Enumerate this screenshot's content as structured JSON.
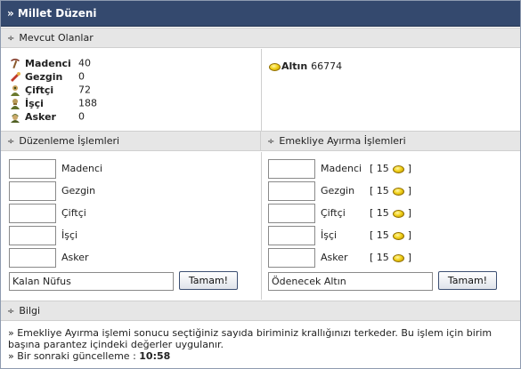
{
  "title": "» Millet Düzeni",
  "sections": {
    "current": "Mevcut Olanlar",
    "edit": "Düzenleme İşlemleri",
    "retire": "Emekliye Ayırma İşlemleri",
    "info": "Bilgi"
  },
  "section_prefix": "÷",
  "population": [
    {
      "name": "Madenci",
      "value": "40",
      "icon": "pickaxe-icon"
    },
    {
      "name": "Gezgin",
      "value": "0",
      "icon": "gezgin-icon"
    },
    {
      "name": "Çiftçi",
      "value": "72",
      "icon": "farmer-icon"
    },
    {
      "name": "İşçi",
      "value": "188",
      "icon": "worker-icon"
    },
    {
      "name": "Asker",
      "value": "0",
      "icon": "soldier-icon"
    }
  ],
  "gold": {
    "label": "Altın",
    "value": "66774"
  },
  "edit_rows": [
    {
      "label": "Madenci",
      "value": ""
    },
    {
      "label": "Gezgin",
      "value": ""
    },
    {
      "label": "Çiftçi",
      "value": ""
    },
    {
      "label": "İşçi",
      "value": ""
    },
    {
      "label": "Asker",
      "value": ""
    }
  ],
  "retire_rows": [
    {
      "label": "Madenci",
      "cost_open": "[ 15",
      "cost_close": "]"
    },
    {
      "label": "Gezgin",
      "cost_open": "[ 15",
      "cost_close": "]"
    },
    {
      "label": "Çiftçi",
      "cost_open": "[ 15",
      "cost_close": "]"
    },
    {
      "label": "İşçi",
      "cost_open": "[ 15",
      "cost_close": "]"
    },
    {
      "label": "Asker",
      "cost_open": "[ 15",
      "cost_close": "]"
    }
  ],
  "remaining_population": "Kalan Nüfus",
  "gold_to_pay": "Ödenecek Altın",
  "ok_button": "Tamam!",
  "info": {
    "line1": "» Emekliye Ayırma işlemi sonucu seçtiğiniz sayıda biriminiz krallığınızı terkeder. Bu işlem için birim başına parantez içindeki değerler uygulanır.",
    "line2_prefix": "» Bir sonraki güncelleme :",
    "line2_time": "10:58"
  },
  "colors": {
    "titlebar": "#34496e",
    "section_bg": "#e6e6e6",
    "button_border": "#3c4f72"
  }
}
